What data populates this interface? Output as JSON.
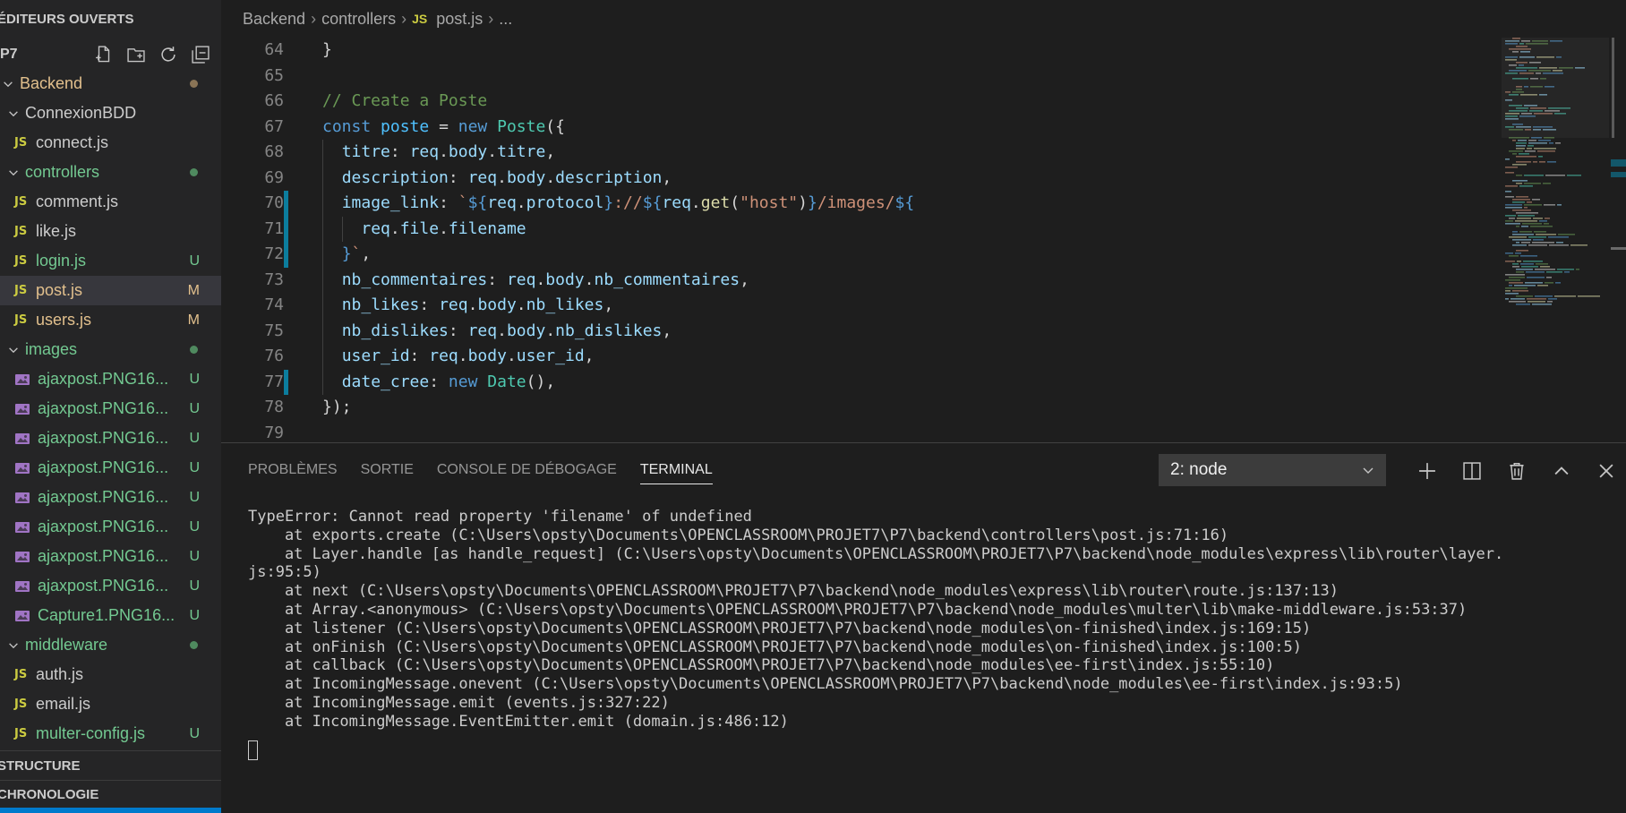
{
  "sidebar": {
    "open_editors_header": "ÉDITEURS OUVERTS",
    "folder_name": "P7",
    "toolbar": [
      "new-file-icon",
      "new-folder-icon",
      "refresh-icon",
      "collapse-all-icon"
    ],
    "tree": [
      {
        "label": "Backend",
        "kind": "folder",
        "depth": 0,
        "color": "c-orange",
        "dot": "#8a7456"
      },
      {
        "label": "ConnexionBDD",
        "kind": "folder",
        "depth": 1,
        "color": "c-default"
      },
      {
        "label": "connect.js",
        "kind": "js",
        "depth": 2,
        "color": "c-default"
      },
      {
        "label": "controllers",
        "kind": "folder",
        "depth": 1,
        "color": "c-green",
        "dot": "#4f8a5f"
      },
      {
        "label": "comment.js",
        "kind": "js",
        "depth": 2,
        "color": "c-default"
      },
      {
        "label": "like.js",
        "kind": "js",
        "depth": 2,
        "color": "c-default"
      },
      {
        "label": "login.js",
        "kind": "js",
        "depth": 2,
        "color": "c-green",
        "badge": "U"
      },
      {
        "label": "post.js",
        "kind": "js",
        "depth": 2,
        "color": "c-orange",
        "badge": "M",
        "selected": true
      },
      {
        "label": "users.js",
        "kind": "js",
        "depth": 2,
        "color": "c-orange",
        "badge": "M"
      },
      {
        "label": "images",
        "kind": "folder",
        "depth": 1,
        "color": "c-green",
        "dot": "#4f8a5f"
      },
      {
        "label": "ajaxpost.PNG16...",
        "kind": "img",
        "depth": 2,
        "color": "c-green",
        "badge": "U"
      },
      {
        "label": "ajaxpost.PNG16...",
        "kind": "img",
        "depth": 2,
        "color": "c-green",
        "badge": "U"
      },
      {
        "label": "ajaxpost.PNG16...",
        "kind": "img",
        "depth": 2,
        "color": "c-green",
        "badge": "U"
      },
      {
        "label": "ajaxpost.PNG16...",
        "kind": "img",
        "depth": 2,
        "color": "c-green",
        "badge": "U"
      },
      {
        "label": "ajaxpost.PNG16...",
        "kind": "img",
        "depth": 2,
        "color": "c-green",
        "badge": "U"
      },
      {
        "label": "ajaxpost.PNG16...",
        "kind": "img",
        "depth": 2,
        "color": "c-green",
        "badge": "U"
      },
      {
        "label": "ajaxpost.PNG16...",
        "kind": "img",
        "depth": 2,
        "color": "c-green",
        "badge": "U"
      },
      {
        "label": "ajaxpost.PNG16...",
        "kind": "img",
        "depth": 2,
        "color": "c-green",
        "badge": "U"
      },
      {
        "label": "Capture1.PNG16...",
        "kind": "img",
        "depth": 2,
        "color": "c-green",
        "badge": "U"
      },
      {
        "label": "middleware",
        "kind": "folder",
        "depth": 1,
        "color": "c-green",
        "dot": "#4f8a5f"
      },
      {
        "label": "auth.js",
        "kind": "js",
        "depth": 2,
        "color": "c-default"
      },
      {
        "label": "email.js",
        "kind": "js",
        "depth": 2,
        "color": "c-default"
      },
      {
        "label": "multer-config.js",
        "kind": "js",
        "depth": 2,
        "color": "c-green",
        "badge": "U"
      }
    ],
    "structure_header": "STRUCTURE",
    "timeline_header": "CHRONOLOGIE"
  },
  "editor": {
    "breadcrumb": [
      "Backend",
      "controllers",
      "post.js",
      "..."
    ],
    "lines": [
      {
        "n": "64",
        "html": "<span class='tk-punc'>}</span>",
        "indent": 0
      },
      {
        "n": "65",
        "html": "",
        "indent": 0
      },
      {
        "n": "66",
        "html": "<span class='tk-cmt'>// Create a Poste</span>",
        "indent": 0
      },
      {
        "n": "67",
        "html": "<span class='tk-kw'>const</span> <span class='tk-var'>poste</span> <span class='tk-punc'>=</span> <span class='tk-kw'>new</span> <span class='tk-cls'>Poste</span><span class='tk-punc'>({</span>",
        "indent": 0
      },
      {
        "n": "68",
        "html": "  <span class='tk-prop'>titre</span><span class='tk-punc'>:</span> <span class='tk-prop'>req</span>.<span class='tk-prop'>body</span>.<span class='tk-prop'>titre</span>,",
        "indent": 1
      },
      {
        "n": "69",
        "html": "  <span class='tk-prop'>description</span><span class='tk-punc'>:</span> <span class='tk-prop'>req</span>.<span class='tk-prop'>body</span>.<span class='tk-prop'>description</span>,",
        "indent": 1
      },
      {
        "n": "70",
        "html": "  <span class='tk-prop'>image_link</span><span class='tk-punc'>:</span> <span class='tk-str'>`</span><span class='tk-tmpl'>${</span><span class='tk-prop'>req</span>.<span class='tk-prop'>protocol</span><span class='tk-tmpl'>}</span><span class='tk-str'>://</span><span class='tk-tmpl'>${</span><span class='tk-prop'>req</span>.<span class='tk-fn'>get</span>(<span class='tk-str'>\"host\"</span>)<span class='tk-tmpl'>}</span><span class='tk-str'>/images/</span><span class='tk-tmpl'>${</span>",
        "indent": 1,
        "mark": "#0c7d9d"
      },
      {
        "n": "71",
        "html": "    <span class='tk-prop'>req</span>.<span class='tk-prop'>file</span>.<span class='tk-prop'>filename</span>",
        "indent": 2,
        "mark": "#0c7d9d"
      },
      {
        "n": "72",
        "html": "  <span class='tk-tmpl'>}</span><span class='tk-str'>`</span>,",
        "indent": 1,
        "mark": "#0c7d9d"
      },
      {
        "n": "73",
        "html": "  <span class='tk-prop'>nb_commentaires</span><span class='tk-punc'>:</span> <span class='tk-prop'>req</span>.<span class='tk-prop'>body</span>.<span class='tk-prop'>nb_commentaires</span>,",
        "indent": 1
      },
      {
        "n": "74",
        "html": "  <span class='tk-prop'>nb_likes</span><span class='tk-punc'>:</span> <span class='tk-prop'>req</span>.<span class='tk-prop'>body</span>.<span class='tk-prop'>nb_likes</span>,",
        "indent": 1
      },
      {
        "n": "75",
        "html": "  <span class='tk-prop'>nb_dislikes</span><span class='tk-punc'>:</span> <span class='tk-prop'>req</span>.<span class='tk-prop'>body</span>.<span class='tk-prop'>nb_dislikes</span>,",
        "indent": 1
      },
      {
        "n": "76",
        "html": "  <span class='tk-prop'>user_id</span><span class='tk-punc'>:</span> <span class='tk-prop'>req</span>.<span class='tk-prop'>body</span>.<span class='tk-prop'>user_id</span>,",
        "indent": 1
      },
      {
        "n": "77",
        "html": "  <span class='tk-prop'>date_cree</span><span class='tk-punc'>:</span> <span class='tk-kw'>new</span> <span class='tk-cls'>Date</span>(),",
        "indent": 1,
        "mark": "#0c7d9d"
      },
      {
        "n": "78",
        "html": "<span class='tk-punc'>});</span>",
        "indent": 0
      },
      {
        "n": "79",
        "html": "",
        "indent": 0
      }
    ]
  },
  "panel": {
    "tabs": [
      "PROBLÈMES",
      "SORTIE",
      "CONSOLE DE DÉBOGAGE",
      "TERMINAL"
    ],
    "active_tab": "TERMINAL",
    "terminal_select": "2: node",
    "actions": [
      "plus-icon",
      "split-icon",
      "trash-icon",
      "chevron-up-icon",
      "close-icon"
    ],
    "terminal_lines": [
      "TypeError: Cannot read property 'filename' of undefined",
      "    at exports.create (C:\\Users\\opsty\\Documents\\OPENCLASSROOM\\PROJET7\\P7\\backend\\controllers\\post.js:71:16)",
      "    at Layer.handle [as handle_request] (C:\\Users\\opsty\\Documents\\OPENCLASSROOM\\PROJET7\\P7\\backend\\node_modules\\express\\lib\\router\\layer.",
      "js:95:5)",
      "    at next (C:\\Users\\opsty\\Documents\\OPENCLASSROOM\\PROJET7\\P7\\backend\\node_modules\\express\\lib\\router\\route.js:137:13)",
      "    at Array.<anonymous> (C:\\Users\\opsty\\Documents\\OPENCLASSROOM\\PROJET7\\P7\\backend\\node_modules\\multer\\lib\\make-middleware.js:53:37)",
      "    at listener (C:\\Users\\opsty\\Documents\\OPENCLASSROOM\\PROJET7\\P7\\backend\\node_modules\\on-finished\\index.js:169:15)",
      "    at onFinish (C:\\Users\\opsty\\Documents\\OPENCLASSROOM\\PROJET7\\P7\\backend\\node_modules\\on-finished\\index.js:100:5)",
      "    at callback (C:\\Users\\opsty\\Documents\\OPENCLASSROOM\\PROJET7\\P7\\backend\\node_modules\\ee-first\\index.js:55:10)",
      "    at IncomingMessage.onevent (C:\\Users\\opsty\\Documents\\OPENCLASSROOM\\PROJET7\\P7\\backend\\node_modules\\ee-first\\index.js:93:5)",
      "    at IncomingMessage.emit (events.js:327:22)",
      "    at IncomingMessage.EventEmitter.emit (domain.js:486:12)"
    ]
  }
}
